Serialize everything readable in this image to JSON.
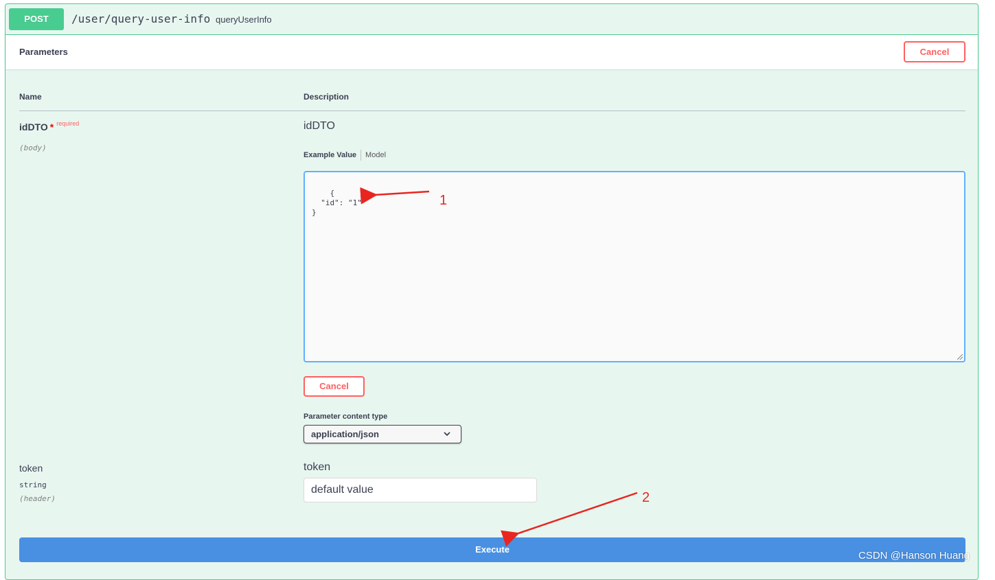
{
  "operation": {
    "method": "POST",
    "path": "/user/query-user-info",
    "operation_id": "queryUserInfo"
  },
  "parameters_section": {
    "title": "Parameters",
    "cancel_label": "Cancel"
  },
  "columns": {
    "name": "Name",
    "description": "Description"
  },
  "params": [
    {
      "name": "idDTO",
      "required_marker": "*",
      "required_label": "required",
      "in": "(body)",
      "description": "idDTO",
      "tab_active": "Example Value",
      "tab_inactive": "Model",
      "body_value": "{\n  \"id\": \"1\"\n}",
      "cancel_label": "Cancel",
      "content_type_label": "Parameter content type",
      "content_type_value": "application/json"
    },
    {
      "name": "token",
      "type": "string",
      "in": "(header)",
      "description": "token",
      "value": "default value"
    }
  ],
  "execute_label": "Execute",
  "annotations": [
    "1",
    "2"
  ],
  "watermark": "CSDN @Hanson Huang",
  "colors": {
    "post_green": "#49cc90",
    "cancel_red": "#ff6060",
    "execute_blue": "#4990e2",
    "annotation_red": "#e8261f"
  }
}
